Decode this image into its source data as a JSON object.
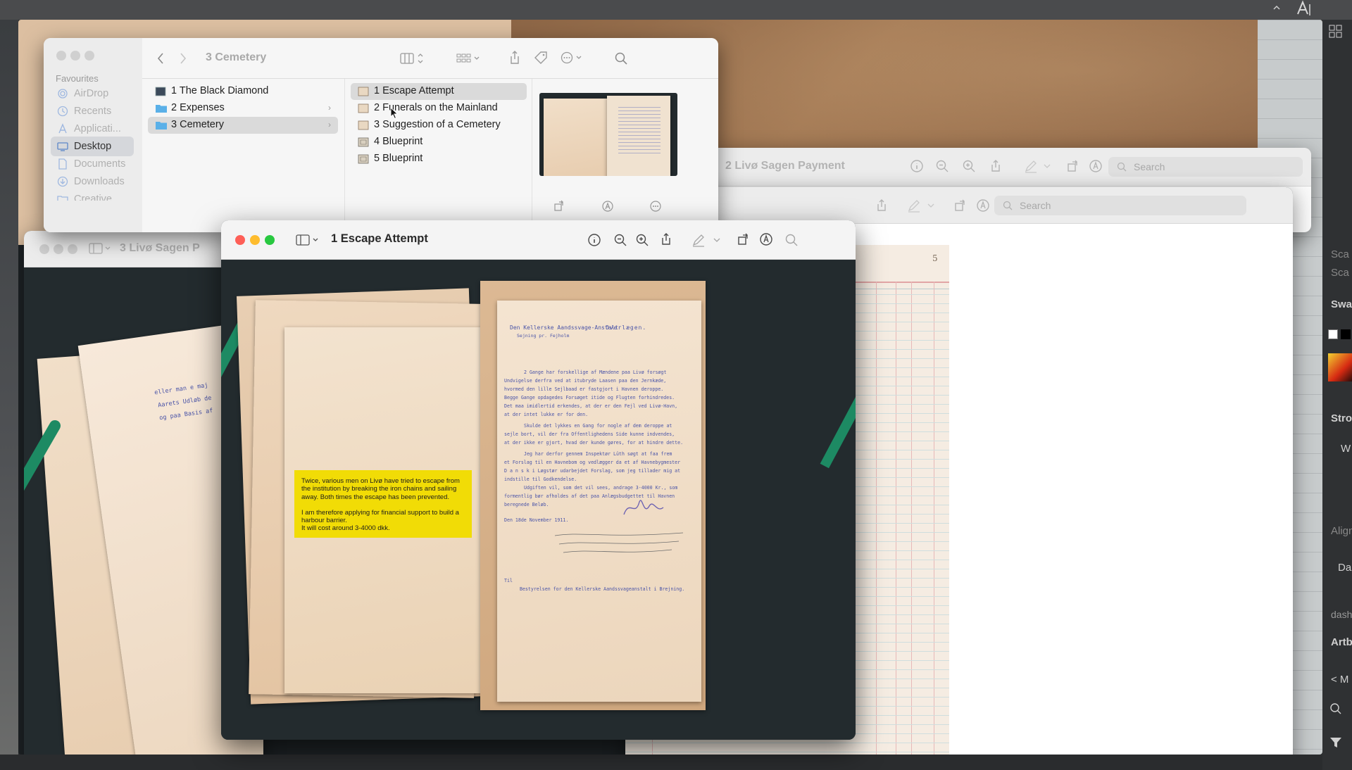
{
  "desktop": {
    "peach_color": "#dcbfa1",
    "wood_color": "#a47a55"
  },
  "finder": {
    "window_title": "3 Cemetery",
    "sidebar": {
      "section": "Favourites",
      "items": [
        {
          "label": "AirDrop",
          "icon": "airdrop-icon"
        },
        {
          "label": "Recents",
          "icon": "clock-icon"
        },
        {
          "label": "Applicati...",
          "icon": "applications-icon"
        },
        {
          "label": "Desktop",
          "icon": "desktop-icon"
        },
        {
          "label": "Documents",
          "icon": "document-icon"
        },
        {
          "label": "Downloads",
          "icon": "download-icon"
        },
        {
          "label": "Creative...",
          "icon": "folder-icon"
        }
      ]
    },
    "column1": [
      {
        "label": "1 The Black Diamond",
        "kind": "image"
      },
      {
        "label": "2 Expenses",
        "kind": "folder"
      },
      {
        "label": "3 Cemetery",
        "kind": "folder"
      }
    ],
    "column2": [
      {
        "label": "1 Escape Attempt"
      },
      {
        "label": "2 Funerals on the Mainland"
      },
      {
        "label": "3 Suggestion of a Cemetery"
      },
      {
        "label": "4 Blueprint"
      },
      {
        "label": "5 Blueprint"
      }
    ]
  },
  "preview_back": {
    "title": "2 Livø Sagen Payment",
    "search_placeholder": "Search"
  },
  "preview_mid": {
    "title": "3 Livø Sagen P",
    "search_placeholder": "Search"
  },
  "preview_front": {
    "title": "1 Escape Attempt"
  },
  "ledger": {
    "page_number": "5"
  },
  "note": {
    "paragraph1": "Twice, various men on Livø have tried to escape from the institution by breaking the iron chains and sailing away. Both times the escape has been prevented.",
    "paragraph2": "I am therefore applying for financial support to build a harbour barrier.",
    "paragraph3": "It will cost around 3-4000 dkk.",
    "color": "#f1dc06"
  },
  "letter": {
    "header_left": "Den Kellerske Aandssvage-Anstalt",
    "header_sub": "Sejning pr. Fejholm",
    "header_right": "Overlægen.",
    "lines": [
      "2 Gange har forskellige af Mændene paa Livø forsøgt",
      "Undvigelse derfra ved at itubryde Laasen paa den Jernkæde,",
      "hvormed den lille Sejlbaad er fastgjort i Havnen deroppe.",
      "Begge Gange opdagedes Forsøget itide og Flugten forhindredes.",
      "Det maa imidlertid erkendes, at der er den Fejl ved Livø-Havn,",
      "at der intet lukke er for den.",
      "Skulde det lykkes en Gang for nogle af dem deroppe at",
      "sejle bort, vil der fra Offentlighedens Side kunne indvendes,",
      "at der ikke er gjort, hvad der kunde gøres, for at hindre dette.",
      "Jeg har derfor gennem Inspektør Lüth søgt at faa frem",
      "et Forslag til en Havnebom og vedlægger da et af Havnebygmester",
      "D a n s k i Løgstør udarbejdet Forslag, som jeg tillader mig at",
      "indstille til Godkendelse.",
      "Udgiften vil, som det vil sees, andrage 3-4000 Kr., som",
      "formentlig bør afholdes af det paa Anlægsbudgettet til Havnen",
      "beregnede Beløb.",
      "Den 18de November 1911.",
      "Til",
      "Bestyrelsen for den Kellerske Aandssvageanstalt i Brejning."
    ]
  },
  "right_panel": {
    "items": [
      "Sca",
      "Sca",
      "Swat",
      "Stro",
      "W",
      "Align",
      "Da",
      "dash",
      "Artbo",
      "< M"
    ]
  }
}
